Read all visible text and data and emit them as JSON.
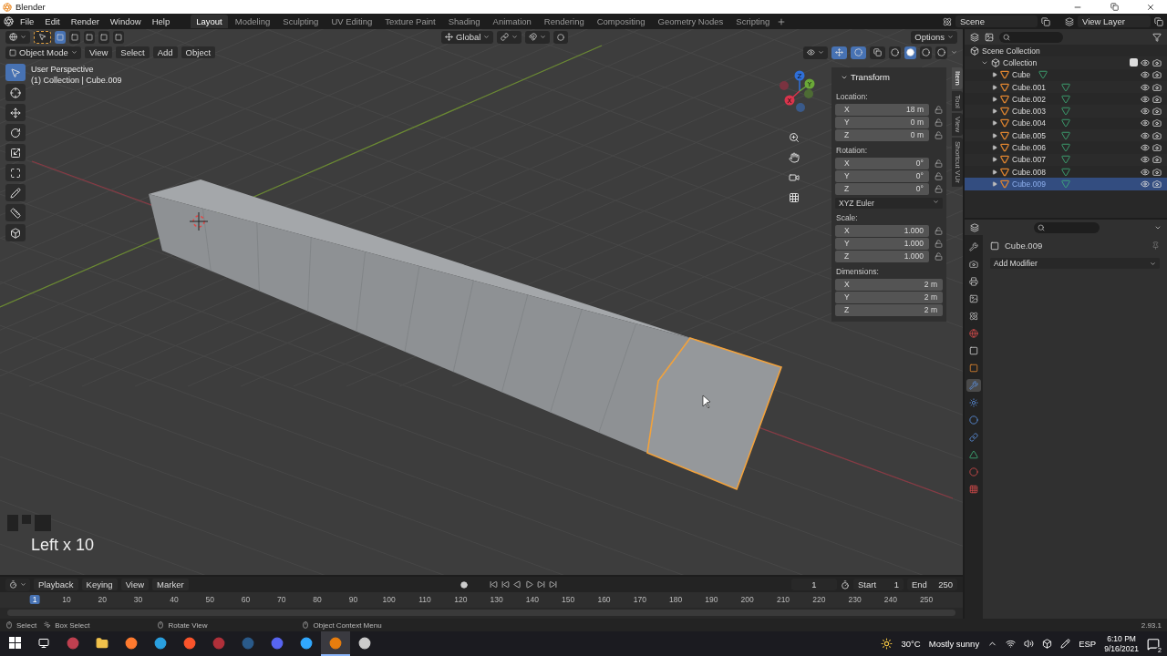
{
  "window": {
    "title": "Blender"
  },
  "menu": [
    "File",
    "Edit",
    "Render",
    "Window",
    "Help"
  ],
  "workspaces": [
    {
      "label": "Layout",
      "selected": true
    },
    {
      "label": "Modeling",
      "selected": false
    },
    {
      "label": "Sculpting",
      "selected": false
    },
    {
      "label": "UV Editing",
      "selected": false
    },
    {
      "label": "Texture Paint",
      "selected": false
    },
    {
      "label": "Shading",
      "selected": false
    },
    {
      "label": "Animation",
      "selected": false
    },
    {
      "label": "Rendering",
      "selected": false
    },
    {
      "label": "Compositing",
      "selected": false
    },
    {
      "label": "Geometry Nodes",
      "selected": false
    },
    {
      "label": "Scripting",
      "selected": false
    }
  ],
  "scene": {
    "name": "Scene"
  },
  "view_layer": {
    "name": "View Layer"
  },
  "viewport": {
    "select_modes": [
      {
        "selected": true
      },
      {
        "selected": false
      },
      {
        "selected": false
      },
      {
        "selected": false
      },
      {
        "selected": false
      }
    ],
    "orientation": "Global",
    "options": "Options",
    "mode": "Object Mode",
    "menus": [
      "View",
      "Select",
      "Add",
      "Object"
    ],
    "shading": [
      {
        "selected": false
      },
      {
        "selected": true
      },
      {
        "selected": false
      },
      {
        "selected": false
      }
    ],
    "view_name": "User Perspective",
    "context": "(1) Collection | Cube.009",
    "gizmo_axes": [
      {
        "label": "Z",
        "color": "#2f6fd8"
      },
      {
        "label": "Y",
        "color": "#6aa838"
      },
      {
        "label": "X",
        "color": "#d8344c"
      }
    ],
    "tools": [
      {
        "kind": "select",
        "selected": true
      },
      {
        "kind": "cursor",
        "selected": false
      },
      {
        "kind": "move",
        "selected": false
      },
      {
        "kind": "rotate",
        "selected": false
      },
      {
        "kind": "scale",
        "selected": false
      },
      {
        "kind": "transform",
        "selected": false
      },
      {
        "kind": "annotate",
        "selected": false
      },
      {
        "kind": "measure",
        "selected": false
      },
      {
        "kind": "add_cube",
        "selected": false
      }
    ],
    "last_operation": "Left x 10"
  },
  "sidebar": {
    "tabs": [
      {
        "label": "Item",
        "selected": true
      },
      {
        "label": "Tool",
        "selected": false
      },
      {
        "label": "View",
        "selected": false
      },
      {
        "label": "Shortcut VUr",
        "selected": false
      }
    ],
    "panel": "Transform",
    "groups": [
      {
        "title": "Location:",
        "lockable": true,
        "fields": [
          {
            "axis": "X",
            "value": "18 m"
          },
          {
            "axis": "Y",
            "value": "0 m"
          },
          {
            "axis": "Z",
            "value": "0 m"
          }
        ]
      },
      {
        "title": "Rotation:",
        "lockable": true,
        "fields": [
          {
            "axis": "X",
            "value": "0°"
          },
          {
            "axis": "Y",
            "value": "0°"
          },
          {
            "axis": "Z",
            "value": "0°"
          }
        ],
        "mode": "XYZ Euler"
      },
      {
        "title": "Scale:",
        "lockable": true,
        "fields": [
          {
            "axis": "X",
            "value": "1.000"
          },
          {
            "axis": "Y",
            "value": "1.000"
          },
          {
            "axis": "Z",
            "value": "1.000"
          }
        ]
      },
      {
        "title": "Dimensions:",
        "lockable": false,
        "fields": [
          {
            "axis": "X",
            "value": "2 m"
          },
          {
            "axis": "Y",
            "value": "2 m"
          },
          {
            "axis": "Z",
            "value": "2 m"
          }
        ]
      }
    ]
  },
  "outliner": {
    "items": [
      {
        "name": "Scene Collection",
        "kind": "scene",
        "selected": false,
        "children": [
          {
            "name": "Collection",
            "kind": "collection",
            "selected": false,
            "expanded": true,
            "checked": true,
            "children": [
              {
                "name": "Cube",
                "kind": "object",
                "selected": false
              },
              {
                "name": "Cube.001",
                "kind": "object",
                "selected": false
              },
              {
                "name": "Cube.002",
                "kind": "object",
                "selected": false
              },
              {
                "name": "Cube.003",
                "kind": "object",
                "selected": false
              },
              {
                "name": "Cube.004",
                "kind": "object",
                "selected": false
              },
              {
                "name": "Cube.005",
                "kind": "object",
                "selected": false
              },
              {
                "name": "Cube.006",
                "kind": "object",
                "selected": false
              },
              {
                "name": "Cube.007",
                "kind": "object",
                "selected": false
              },
              {
                "name": "Cube.008",
                "kind": "object",
                "selected": false
              },
              {
                "name": "Cube.009",
                "kind": "object",
                "selected": true
              }
            ]
          }
        ]
      }
    ]
  },
  "properties": {
    "tabs": [
      {
        "kind": "tool",
        "selected": false
      },
      {
        "kind": "render",
        "selected": false
      },
      {
        "kind": "output",
        "selected": false
      },
      {
        "kind": "view_layer",
        "selected": false
      },
      {
        "kind": "scene",
        "selected": false
      },
      {
        "kind": "world",
        "selected": false
      },
      {
        "kind": "collection",
        "selected": false
      },
      {
        "kind": "object",
        "selected": false
      },
      {
        "kind": "modifiers",
        "selected": true
      },
      {
        "kind": "particles",
        "selected": false
      },
      {
        "kind": "physics",
        "selected": false
      },
      {
        "kind": "constraints",
        "selected": false
      },
      {
        "kind": "data",
        "selected": false
      },
      {
        "kind": "material",
        "selected": false
      },
      {
        "kind": "texture",
        "selected": false
      }
    ],
    "object_name": "Cube.009",
    "add_modifier": "Add Modifier"
  },
  "timeline": {
    "menus": [
      "Playback",
      "Keying",
      "View",
      "Marker"
    ],
    "current_frame": "1",
    "start_label": "Start",
    "start": "1",
    "end_label": "End",
    "end": "250",
    "ruler": [
      {
        "label": "1",
        "selected": true
      },
      {
        "label": "10",
        "selected": false
      },
      {
        "label": "20",
        "selected": false
      },
      {
        "label": "30",
        "selected": false
      },
      {
        "label": "40",
        "selected": false
      },
      {
        "label": "50",
        "selected": false
      },
      {
        "label": "60",
        "selected": false
      },
      {
        "label": "70",
        "selected": false
      },
      {
        "label": "80",
        "selected": false
      },
      {
        "label": "90",
        "selected": false
      },
      {
        "label": "100",
        "selected": false
      },
      {
        "label": "110",
        "selected": false
      },
      {
        "label": "120",
        "selected": false
      },
      {
        "label": "130",
        "selected": false
      },
      {
        "label": "140",
        "selected": false
      },
      {
        "label": "150",
        "selected": false
      },
      {
        "label": "160",
        "selected": false
      },
      {
        "label": "170",
        "selected": false
      },
      {
        "label": "180",
        "selected": false
      },
      {
        "label": "190",
        "selected": false
      },
      {
        "label": "200",
        "selected": false
      },
      {
        "label": "210",
        "selected": false
      },
      {
        "label": "220",
        "selected": false
      },
      {
        "label": "230",
        "selected": false
      },
      {
        "label": "240",
        "selected": false
      },
      {
        "label": "250",
        "selected": false
      }
    ]
  },
  "status_bar": {
    "hints": [
      {
        "kind": "left",
        "label": "Select"
      },
      {
        "kind": "drag",
        "label": "Box Select"
      },
      {
        "kind": "middle",
        "label": "Rotate View"
      },
      {
        "kind": "right",
        "label": "Object Context Menu"
      }
    ],
    "version": "2.93.1"
  },
  "taskbar": {
    "apps": [
      {
        "kind": "app",
        "selected": false
      },
      {
        "kind": "files",
        "selected": false
      },
      {
        "kind": "firefox",
        "selected": false
      },
      {
        "kind": "edge",
        "selected": false
      },
      {
        "kind": "brave",
        "selected": false
      },
      {
        "kind": "app2",
        "selected": false
      },
      {
        "kind": "steam",
        "selected": false
      },
      {
        "kind": "discord",
        "selected": false
      },
      {
        "kind": "photoshop",
        "selected": false
      },
      {
        "kind": "blender",
        "selected": true
      },
      {
        "kind": "obs",
        "selected": false
      }
    ],
    "temperature": "30°C",
    "weather": "Mostly sunny",
    "language": "ESP",
    "time": "6:10 PM",
    "date": "9/16/2021",
    "notifications": "2"
  }
}
